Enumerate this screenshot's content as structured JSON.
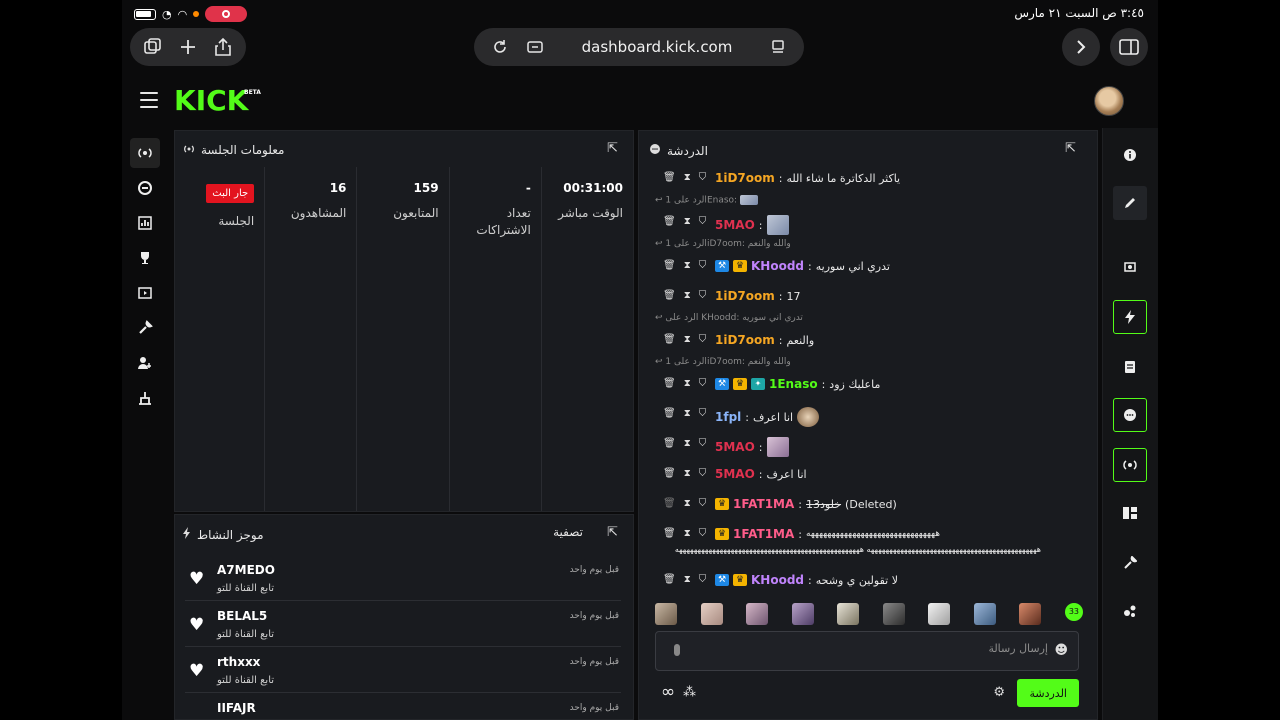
{
  "status_bar": {
    "time_date": "٣:٤٥ ص   السبت ٢١ مارس"
  },
  "browser": {
    "url": "dashboard.kick.com"
  },
  "app": {
    "logo_text": "KICK",
    "logo_badge": "BETA"
  },
  "session_panel": {
    "title": "معلومات الجلسة",
    "stats": [
      {
        "value": "00:31:00",
        "label": "الوقت مباشر"
      },
      {
        "value": "-",
        "label": "تعداد الاشتراكات"
      },
      {
        "value": "159",
        "label": "المتابعون"
      },
      {
        "value": "16",
        "label": "المشاهدون"
      },
      {
        "value": "جار البث",
        "label": "الجلسة"
      }
    ]
  },
  "activity_panel": {
    "title": "موجز النشاط",
    "filter_label": "تصفية",
    "items": [
      {
        "name": "A7MEDO",
        "action": "تابع القناة للتو",
        "time": "قبل يوم واحد"
      },
      {
        "name": "BELAL5",
        "action": "تابع القناة للتو",
        "time": "قبل يوم واحد"
      },
      {
        "name": "rthxxx",
        "action": "تابع القناة للتو",
        "time": "قبل يوم واحد"
      },
      {
        "name": "IIFAJR",
        "action": "",
        "time": "قبل يوم واحد"
      }
    ]
  },
  "chat_panel": {
    "title": "الدردشة",
    "messages": [
      {
        "user": "1iD7oom",
        "user_color": "#f5a623",
        "text": "ياكثر الدكاترة ما شاء الله"
      },
      {
        "reply_to": "الرد على 1Enaso:"
      },
      {
        "user": "5MAO",
        "user_color": "#e0314f",
        "text": ""
      },
      {
        "reply_to": "الرد على 1iD7oom: والله والنعم"
      },
      {
        "user": "KHoodd",
        "user_color": "#c084fc",
        "text": "تدري اني سوريه"
      },
      {
        "user": "1iD7oom",
        "user_color": "#f5a623",
        "text": "17"
      },
      {
        "reply_to": "الرد على KHoodd: تدري اني سوريه"
      },
      {
        "user": "1iD7oom",
        "user_color": "#f5a623",
        "text": "والنعم"
      },
      {
        "reply_to": "الرد على 1iD7oom: والله والنعم"
      },
      {
        "user": "1Enaso",
        "user_color": "#53fc18",
        "text": "ماعليك زود"
      },
      {
        "user": "1fpl",
        "user_color": "#8ab4f8",
        "text": "انا اعرف"
      },
      {
        "user": "5MAO",
        "user_color": "#e0314f",
        "text": ""
      },
      {
        "user": "5MAO",
        "user_color": "#e0314f",
        "text": "انا اعرف"
      },
      {
        "user": "1FAT1MA",
        "user_color": "#ff5c8a",
        "text": "خلود13",
        "suffix": "(Deleted)"
      },
      {
        "user": "1FAT1MA",
        "user_color": "#ff5c8a",
        "text": "هههههههههههههههههههههههههههههههه"
      },
      {
        "user": "KHoodd",
        "user_color": "#c084fc",
        "text": "لا تقولين ي وشحه"
      }
    ],
    "overflow_line": "ههههههههههههههههههههههههههههههههههههههههههههههه ههههههههههههههههههههههههههههههههههههههههههههههههههه",
    "emote_badge": "33",
    "input_placeholder": "إرسال رسالة",
    "send_label": "الدردشة"
  },
  "colors": {
    "kick_green": "#53fc18",
    "live_red": "#e3141f",
    "panel_bg": "#191b1f"
  }
}
